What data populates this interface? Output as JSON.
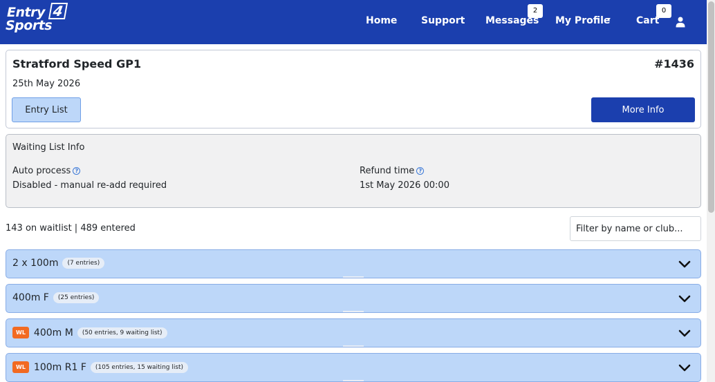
{
  "header": {
    "logo_line1": "Entry",
    "logo_four": "4",
    "logo_line2": "Sports",
    "nav": {
      "home": "Home",
      "support": "Support",
      "messages": "Messages",
      "messages_count": "2",
      "profile": "My Profile",
      "cart": "Cart",
      "cart_count": "0"
    },
    "brand_color": "#1b3fae"
  },
  "event": {
    "title": "Stratford Speed GP1",
    "number": "#1436",
    "date": "25th May 2026",
    "entry_list_label": "Entry List",
    "more_info_label": "More Info"
  },
  "waiting_list": {
    "title": "Waiting List Info",
    "auto_process_label": "Auto process",
    "auto_process_value": "Disabled - manual re-add required",
    "refund_label": "Refund time",
    "refund_value": "1st May 2026 00:00",
    "help_icon": "question-circle-icon"
  },
  "summary": "143 on waitlist | 489 entered",
  "filter": {
    "placeholder": "Filter by name or club..."
  },
  "events": [
    {
      "wl": "",
      "name": "2 x 100m",
      "count": "(7 entries)"
    },
    {
      "wl": "",
      "name": "400m F",
      "count": "(25 entries)"
    },
    {
      "wl": "WL",
      "name": "400m M",
      "count": "(50 entries, 9 waiting list)"
    },
    {
      "wl": "WL",
      "name": "100m R1 F",
      "count": "(105 entries, 15 waiting list)"
    }
  ],
  "colors": {
    "accordion": "#bdd7f9",
    "wl_tag": "#f26a21"
  }
}
